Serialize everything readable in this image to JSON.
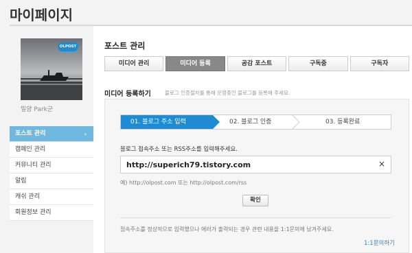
{
  "page": {
    "title": "마이페이지"
  },
  "profile": {
    "name": "밀양 Park군",
    "brand_badge": "OLPOST"
  },
  "sidebar": {
    "items": [
      {
        "label": "포스트 관리",
        "active": true,
        "arrow": "›"
      },
      {
        "label": "캠페인 관리"
      },
      {
        "label": "커뮤니티 관리"
      },
      {
        "label": "알림"
      },
      {
        "label": "캐쉬 관리"
      },
      {
        "label": "회원정보 관리"
      }
    ]
  },
  "main": {
    "title": "포스트 관리",
    "tabs": [
      {
        "label": "미디어 관리"
      },
      {
        "label": "미디어 등록",
        "active": true
      },
      {
        "label": "공감 포스트"
      },
      {
        "label": "구독중"
      },
      {
        "label": "구독자"
      }
    ],
    "subtitle": "미디어 등록하기",
    "subtitle_desc": "블로그 인증절차를 통해 운영중인 블로그를 등록해 주세요."
  },
  "steps": [
    {
      "label": "01. 블로그 주소 입력",
      "active": true
    },
    {
      "label": "02. 블로그 인증"
    },
    {
      "label": "03. 등록완료"
    }
  ],
  "form": {
    "label": "블로그 접속주소 또는 RSS주소를 입력해주세요.",
    "url_value": "http://superich79.tistory.com",
    "clear_icon": "×",
    "example": "예) http://olpost.com 또는 http://olpost.com/rss",
    "confirm_label": "확인"
  },
  "footer": {
    "notice": "접속주소를 정상적으로 입력했으나 에러가 출력되는 경우 관련 내용을 1:1문의에 남겨주세요.",
    "inquiry_link": "1:1문의하기"
  },
  "colors": {
    "accent": "#1e8bd3",
    "sidebar_active": "#6fb8e0",
    "tab_active": "#888888",
    "link": "#3a7fc1"
  },
  "icons": {
    "clear": "close-icon",
    "sidebar_arrow": "chevron-right-icon"
  }
}
